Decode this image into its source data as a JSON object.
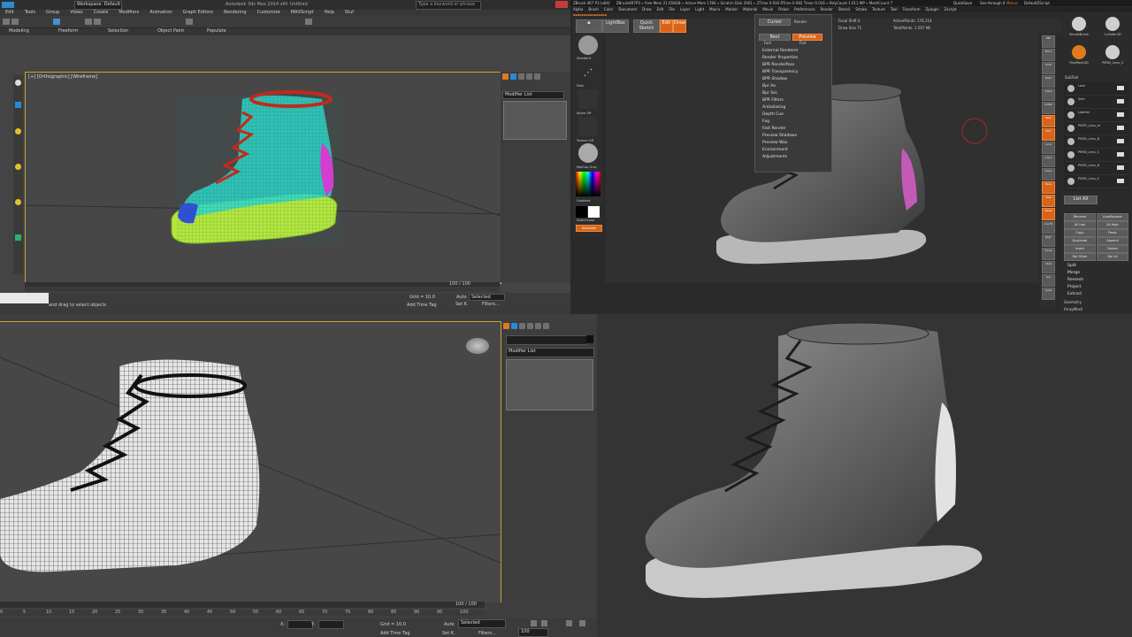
{
  "max_top": {
    "title": "Autodesk 3ds Max 2014 x64",
    "untitled": "Untitled",
    "workspace_label": "Workspace: Default",
    "search_placeholder": "Type a keyword or phrase",
    "menus": [
      "Edit",
      "Tools",
      "Group",
      "Views",
      "Create",
      "Modifiers",
      "Animation",
      "Graph Editors",
      "Rendering",
      "Customize",
      "MAXScript",
      "Help",
      "Stuf"
    ],
    "ribbon_tabs": [
      "Modeling",
      "Freeform",
      "Selection",
      "Object Paint",
      "Populate"
    ],
    "viewport_label": "[+] [Orthographic] [Wireframe]",
    "modifier_list": "Modifier List",
    "frame_counter": "100 / 100",
    "status_text": "and drag to select objects",
    "grid": "Grid = 10.0",
    "auto": "Auto",
    "selected": "Selected",
    "set_k": "Set K.",
    "filters": "Filters...",
    "add_time_tag": "Add Time Tag"
  },
  "zbrush": {
    "title": "ZBrush 4R7 P3 (x64)",
    "info_line": "ZBrush4R7P3 » Free Mem 21.658GB » Active Mem 1784 » Scratch Disk 2901 » ZTime 0.916 RTime 0.082 Timer 0.016 » PolyCount 1.611 MP » MeshCount 7",
    "quicksave": "QuickSave",
    "see_through": "See-through 0",
    "menus_label": "Menus",
    "default_script": "DefaultZScript",
    "menus": [
      "Alpha",
      "Brush",
      "Color",
      "Document",
      "Draw",
      "Edit",
      "File",
      "Layer",
      "Light",
      "Macro",
      "Marker",
      "Material",
      "Movie",
      "Picker",
      "Preferences",
      "Render",
      "Stencil",
      "Stroke",
      "Texture",
      "Tool",
      "Transform",
      "Zplugin",
      "Zscript"
    ],
    "lightbox": "LightBox",
    "quick_sketch": "Quick Sketch",
    "edit": "Edit",
    "draw": "Draw",
    "focal_shift": "Focal Shift 0",
    "draw_size": "Draw Size 71",
    "active_points": "ActivePoints: 176,114",
    "total_points": "TotalPoints: 1.567 Mil",
    "brush_label": "Standard",
    "stroke_label": "Dots",
    "alpha_label": "Alpha Off",
    "texture_label": "Texture Off",
    "material_label": "MatCap Gray",
    "gradient_label": "Gradient",
    "switch_color": "SwitchColor",
    "alternate": "Alternate",
    "render_menu_top": [
      "Cursor",
      "Render"
    ],
    "render_menu_options": [
      "Best",
      "Preview",
      "Fast",
      "Flat"
    ],
    "render_menu_items": [
      "External Renderer",
      "Render Properties",
      "BPR RenderPass",
      "BPR Transparency",
      "BPR Shadow",
      "Bpr Ao",
      "Bpr Sss",
      "BPR Filters",
      "Antialiasing",
      "Depth Cue",
      "Fog",
      "Fast Render",
      "Preview Shadows",
      "Preview Wax",
      "Environment",
      "Adjustments"
    ],
    "right_buttons": [
      "BPR",
      "SPix 3",
      "Scroll",
      "Zoom",
      "Actual",
      "AAHalf",
      "Persp",
      "Floor",
      "Local",
      "L.Sym",
      "Frame",
      "Move",
      "Scale",
      "Rotate",
      "Line Fill",
      "PolyF",
      "Transp",
      "Ghost",
      "Solo",
      "Xpose"
    ],
    "subtool_label": "SubTool",
    "subtools": [
      "Lace",
      "Sole",
      "Leather",
      "PM3D_Lens_Ar",
      "PM3D_Lens_B",
      "PM3D_Lens_C",
      "PM3D_Lens_D",
      "PM3D_Lens_E"
    ],
    "tool_icons": [
      "SimpleBrush",
      "Cylinder3D",
      "PolyMesh3D",
      "PM3D_Lens_S"
    ],
    "list_all": "List All",
    "subtool_ops": [
      "Rename",
      "AutoReorder",
      "All Low",
      "All High",
      "Copy",
      "Paste",
      "Duplicate",
      "Append",
      "Insert",
      "Delete",
      "Del Other",
      "Del All"
    ],
    "subtool_sections": [
      "Split",
      "Merge",
      "Remesh",
      "Project",
      "Extract"
    ],
    "geometry": "Geometry",
    "array_mesh": "ArrayMesh"
  },
  "max_bottom": {
    "modifier_list": "Modifier List",
    "frame_counter": "100 / 100",
    "timeline_ticks": [
      "0",
      "5",
      "10",
      "15",
      "20",
      "25",
      "30",
      "35",
      "40",
      "45",
      "50",
      "55",
      "60",
      "65",
      "70",
      "75",
      "80",
      "85",
      "90",
      "95",
      "100"
    ],
    "x_label": "X:",
    "y_label": "Y:",
    "grid": "Grid = 10.0",
    "auto": "Auto",
    "selected": "Selected",
    "set_k": "Set K.",
    "filters": "Filters...",
    "add_time_tag": "Add Time Tag",
    "frame_input": "100"
  },
  "colors": {
    "max_bg": "#3f3f3f",
    "max_viewport": "#474747",
    "zbrush_bg": "#2a2a2a",
    "zbrush_orange": "#e0771e",
    "wire_cyan": "#2ed6c8",
    "wire_green": "#b6e63c",
    "wire_red": "#c02a1e",
    "wire_magenta": "#d33dd0"
  }
}
